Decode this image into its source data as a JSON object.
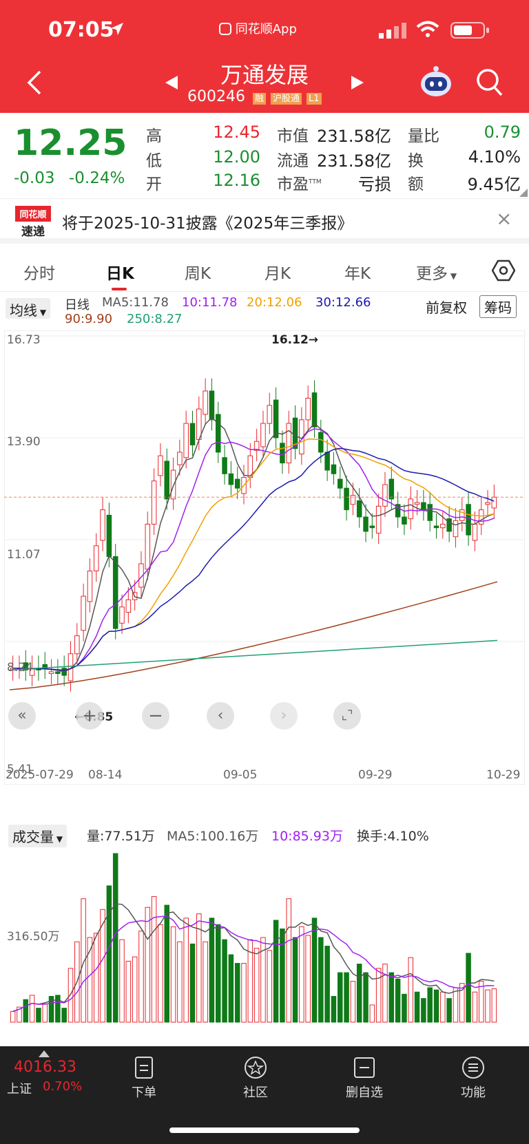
{
  "status": {
    "time": "07:05",
    "app_label": "同花顺App"
  },
  "header": {
    "title": "万通发展",
    "code": "600246",
    "badges": [
      "融",
      "沪股通",
      "L1"
    ]
  },
  "quote": {
    "price": "12.25",
    "change": "-0.03",
    "change_pct": "-0.24%",
    "rows": [
      {
        "l1": "高",
        "v1": "12.45",
        "l2": "市值",
        "v2": "231.58亿",
        "l3": "量比",
        "v3": "0.79"
      },
      {
        "l1": "低",
        "v1": "12.00",
        "l2": "流通",
        "v2": "231.58亿",
        "l3": "换",
        "v3": "4.10%"
      },
      {
        "l1": "开",
        "v1": "12.16",
        "l2": "市盈",
        "l2_sup": "TTM",
        "v2": "亏损",
        "l3": "额",
        "v3": "9.45亿"
      }
    ]
  },
  "notice": {
    "logo_line1": "同花顺",
    "logo_line2": "速递",
    "text": "将于2025-10-31披露《2025年三季报》",
    "close": "×"
  },
  "tabs": [
    "分时",
    "日K",
    "周K",
    "月K",
    "年K",
    "更多"
  ],
  "ma_bar": {
    "selector": "均线",
    "label": "日线",
    "ma5": "MA5:11.78",
    "ma10": "10:11.78",
    "ma20": "20:12.06",
    "ma30": "30:12.66",
    "ma90": "90:9.90",
    "ma250": "250:8.27",
    "fq": "前复权",
    "chip": "筹码"
  },
  "chart": {
    "yticks": [
      "16.73",
      "13.90",
      "11.07",
      "8.24",
      "5.41"
    ],
    "xticks": [
      "2025-07-29",
      "08-14",
      "09-05",
      "09-29",
      "10-29"
    ],
    "high_label": "16.12→",
    "low_label": "←6.85"
  },
  "chart_data": {
    "type": "candlestick",
    "ylim": [
      5.41,
      16.73
    ],
    "x_range": [
      "2025-07-29",
      "2025-10-29"
    ],
    "highest": 16.12,
    "lowest": 6.85,
    "last_close": 12.25,
    "series": [
      {
        "name": "MA5",
        "last": 11.78
      },
      {
        "name": "MA10",
        "last": 11.78
      },
      {
        "name": "MA20",
        "last": 12.06
      },
      {
        "name": "MA30",
        "last": 12.66
      },
      {
        "name": "MA90",
        "last": 9.9
      },
      {
        "name": "MA250",
        "last": 8.27
      }
    ],
    "closes": [
      7.5,
      7.5,
      7.45,
      7.5,
      7.45,
      7.5,
      7.4,
      7.35,
      7.3,
      7.9,
      8.4,
      9.5,
      10.2,
      10.9,
      11.9,
      10.6,
      8.6,
      9.2,
      9.4,
      9.6,
      10.4,
      11.5,
      12.7,
      13.4,
      12.2,
      13.0,
      13.5,
      14.3,
      13.7,
      14.7,
      15.2,
      14.4,
      13.5,
      12.9,
      12.6,
      12.5,
      12.8,
      13.4,
      13.8,
      14.3,
      14.8,
      13.9,
      13.2,
      14.3,
      13.6,
      14.4,
      15.0,
      14.2,
      13.5,
      13.0,
      12.9,
      12.5,
      11.9,
      12.3,
      11.7,
      11.3,
      11.4,
      12.0,
      12.6,
      12.2,
      11.7,
      11.5,
      12.2,
      12.1,
      11.9,
      11.6,
      11.4,
      11.5,
      11.3,
      11.6,
      11.9,
      11.2,
      11.5,
      11.9,
      12.1,
      12.25
    ],
    "volume_ylabel": "316.50万",
    "volume_series": [
      {
        "name": "量",
        "last": "77.51万"
      },
      {
        "name": "MA5",
        "last": "100.16万"
      },
      {
        "name": "MA10",
        "last": "85.93万"
      }
    ]
  },
  "volume": {
    "selector": "成交量",
    "vol": "量:77.51万",
    "ma5": "MA5:100.16万",
    "ma10": "10:85.93万",
    "turnover": "换手:4.10%",
    "ytick": "316.50万"
  },
  "bottom": {
    "index_value": "4016.33",
    "index_name": "上证",
    "index_pct": "0.70%",
    "nav": [
      "下单",
      "社区",
      "删自选",
      "功能"
    ]
  },
  "colors": {
    "header_red": "#ec3237",
    "up": "#e8262d",
    "down": "#0f7a18",
    "ma5": "#555555",
    "ma10": "#a020f0",
    "ma20": "#f0a000",
    "ma30": "#1a1ab0",
    "ma90": "#a0401a",
    "ma250": "#20a070"
  }
}
